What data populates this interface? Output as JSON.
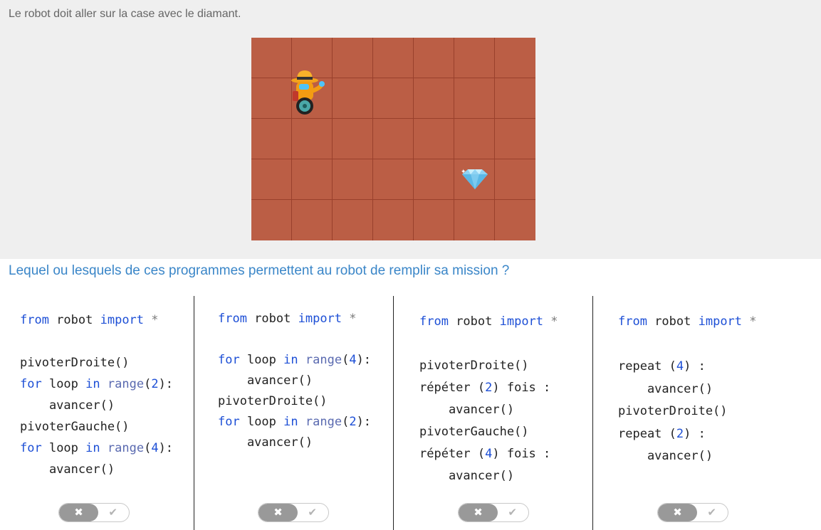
{
  "instruction": "Le robot doit aller sur la case avec le diamant.",
  "question": "Lequel ou lesquels de ces programmes permettent au robot de remplir sa mission ?",
  "board": {
    "columns": 7,
    "rows": 5,
    "robot_cell": {
      "row": 2,
      "col": 2
    },
    "diamond_cell": {
      "row": 4,
      "col": 6
    },
    "colors": {
      "floor": "#bb5e45",
      "grid_lines": "#99402c"
    }
  },
  "toggle": {
    "no_symbol": "✖",
    "yes_symbol": "✔"
  },
  "programs": [
    {
      "lines": [
        "from robot import *",
        "",
        "pivoterDroite()",
        "for loop in range(2):",
        "    avancer()",
        "pivoterGauche()",
        "for loop in range(4):",
        "    avancer()"
      ]
    },
    {
      "lines": [
        "from robot import *",
        "",
        "for loop in range(4):",
        "    avancer()",
        "pivoterDroite()",
        "for loop in range(2):",
        "    avancer()"
      ]
    },
    {
      "lines": [
        "from robot import *",
        "",
        "pivoterDroite()",
        "répéter (2) fois :",
        "    avancer()",
        "pivoterGauche()",
        "répéter (4) fois :",
        "    avancer()"
      ]
    },
    {
      "lines": [
        "from robot import *",
        "",
        "repeat (4) :",
        "    avancer()",
        "pivoterDroite()",
        "repeat (2) :",
        "    avancer()"
      ]
    }
  ],
  "icons": {
    "robot": "robot-icon",
    "diamond": "diamond-icon",
    "cross": "cross-icon",
    "check": "check-icon"
  }
}
